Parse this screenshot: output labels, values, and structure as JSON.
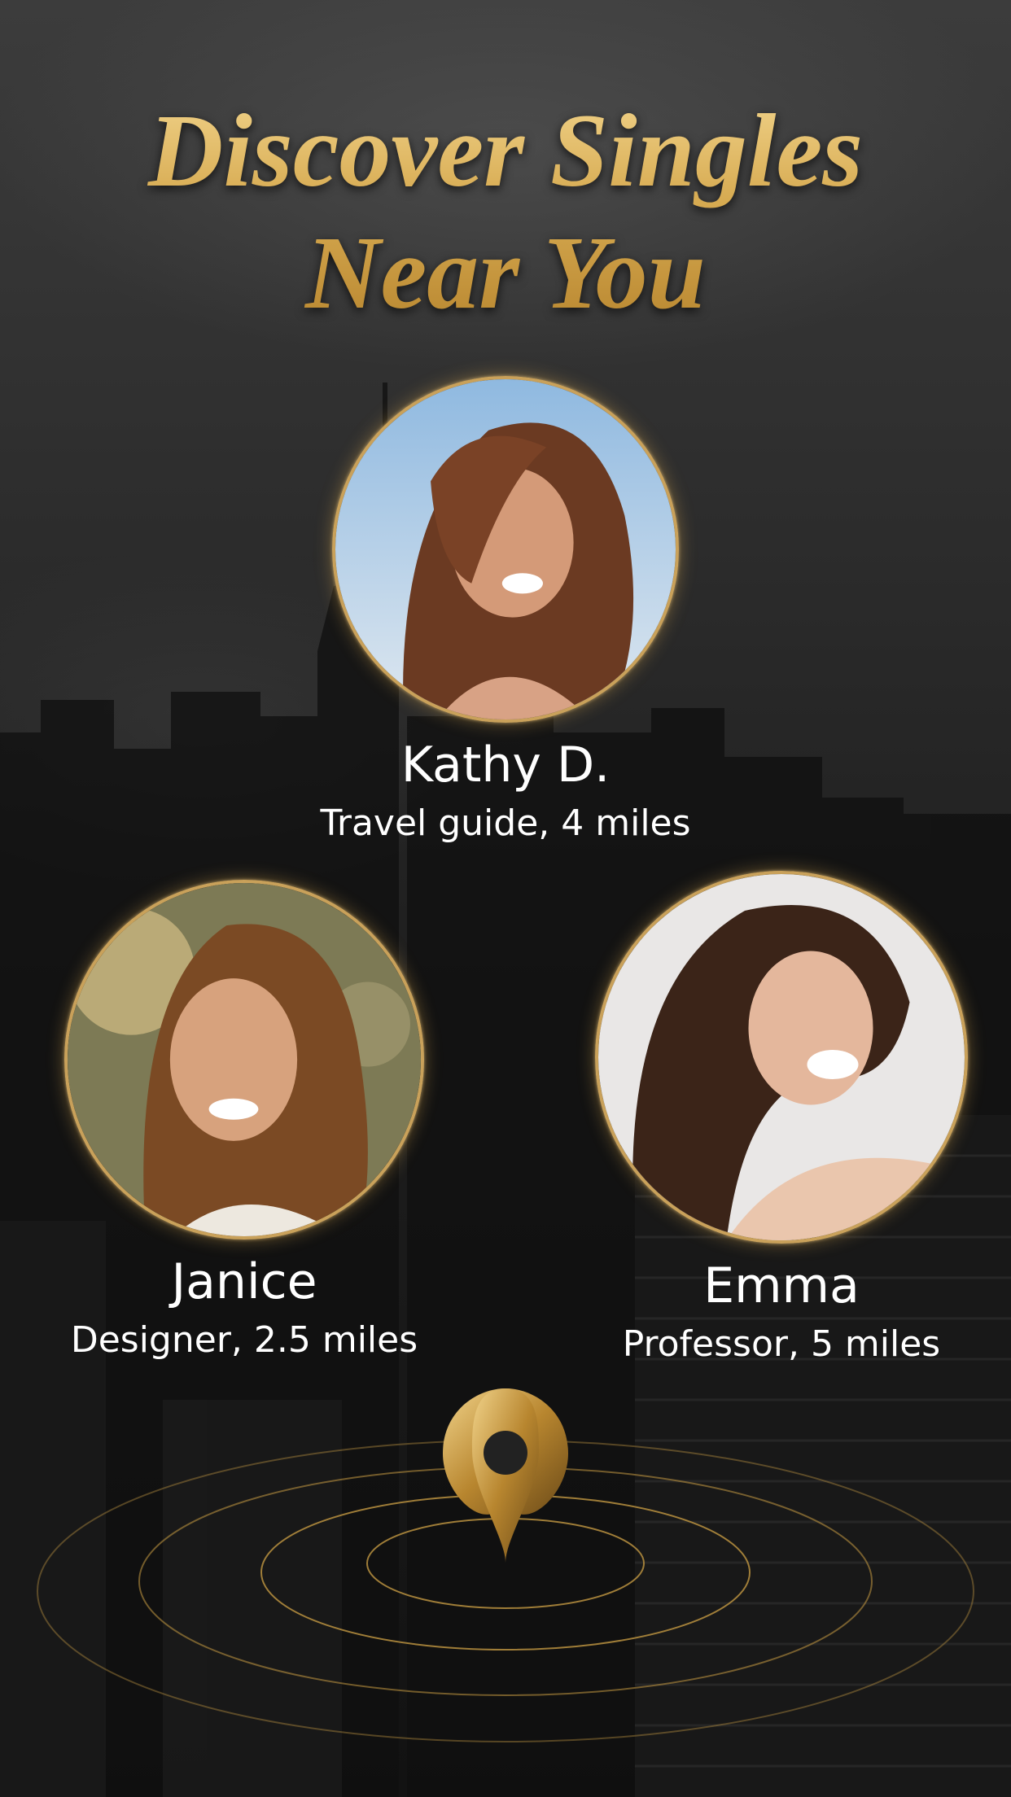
{
  "headline": {
    "line1": "Discover Singles",
    "line2": "Near You"
  },
  "profiles": [
    {
      "name": "Kathy D.",
      "detail": "Travel guide, 4 miles"
    },
    {
      "name": "Janice",
      "detail": "Designer, 2.5 miles"
    },
    {
      "name": "Emma",
      "detail": "Professor, 5 miles"
    }
  ],
  "icons": {
    "location": "map-pin-icon"
  },
  "colors": {
    "gold": "#c9a15a",
    "gold_light": "#f1d38a",
    "gold_dark": "#8a6424",
    "text": "#ffffff",
    "background": "#1e1e1e"
  }
}
